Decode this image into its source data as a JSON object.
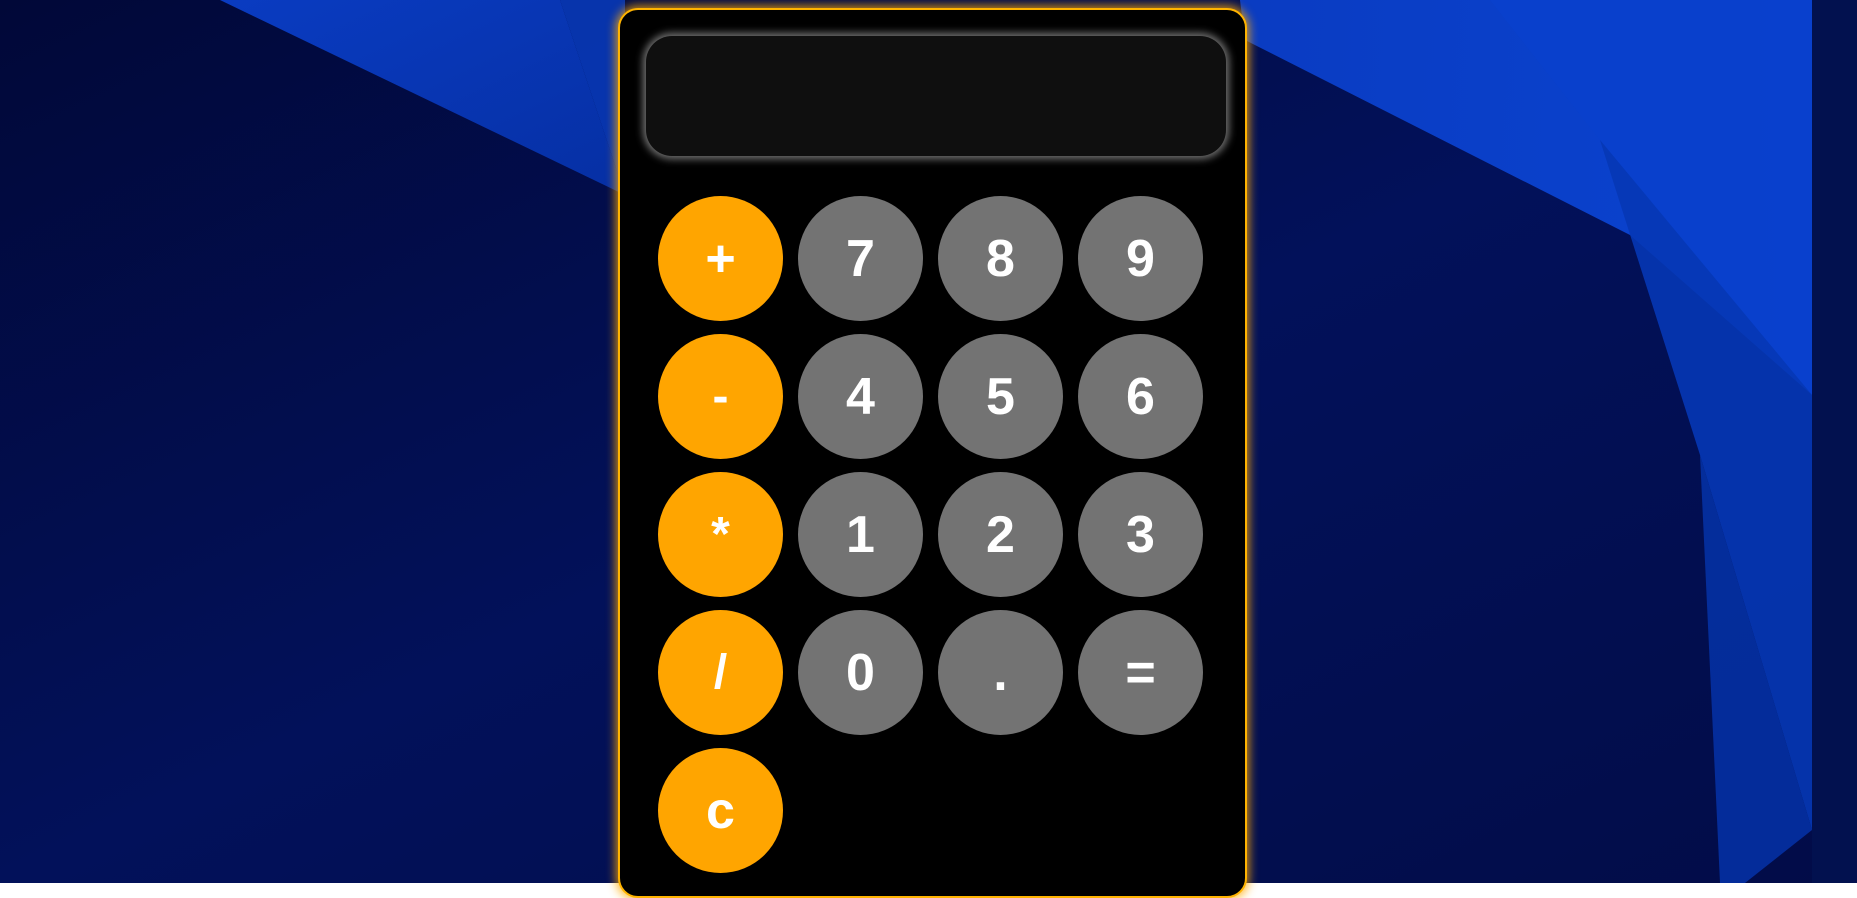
{
  "colors": {
    "wallpaper_dark": "#020a45",
    "wallpaper_light": "#0a3fcc",
    "calculator_body": "#000000",
    "calculator_border": "#ffb300",
    "display_background": "#0f0f0f",
    "operator_key": "#ffa500",
    "number_key": "#737373",
    "key_text": "#ffffff"
  },
  "calculator": {
    "display_value": "",
    "keys": {
      "plus": "+",
      "minus": "-",
      "multiply": "*",
      "divide": "/",
      "clear": "c",
      "seven": "7",
      "eight": "8",
      "nine": "9",
      "four": "4",
      "five": "5",
      "six": "6",
      "one": "1",
      "two": "2",
      "three": "3",
      "zero": "0",
      "decimal": ".",
      "equals": "="
    }
  }
}
